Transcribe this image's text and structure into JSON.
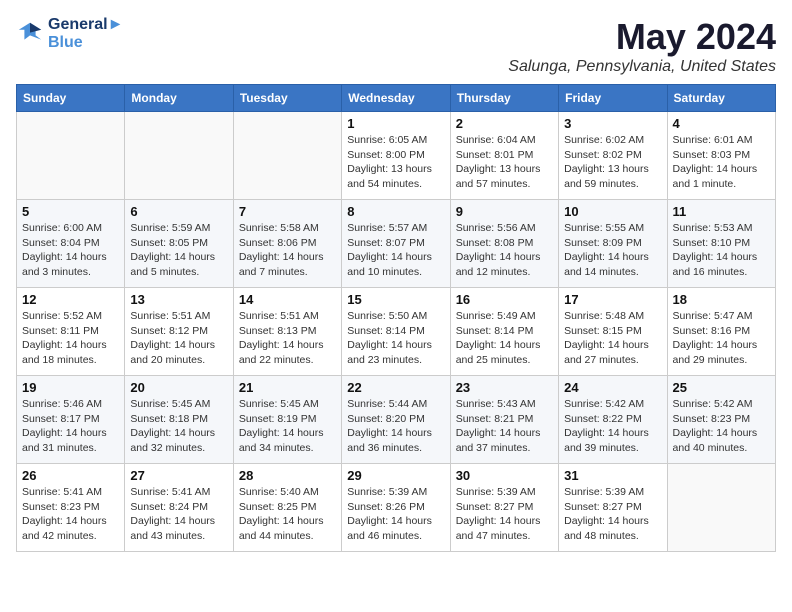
{
  "logo": {
    "line1": "General",
    "line2": "Blue"
  },
  "title": "May 2024",
  "location": "Salunga, Pennsylvania, United States",
  "days_of_week": [
    "Sunday",
    "Monday",
    "Tuesday",
    "Wednesday",
    "Thursday",
    "Friday",
    "Saturday"
  ],
  "weeks": [
    [
      {
        "day": "",
        "info": ""
      },
      {
        "day": "",
        "info": ""
      },
      {
        "day": "",
        "info": ""
      },
      {
        "day": "1",
        "info": "Sunrise: 6:05 AM\nSunset: 8:00 PM\nDaylight: 13 hours\nand 54 minutes."
      },
      {
        "day": "2",
        "info": "Sunrise: 6:04 AM\nSunset: 8:01 PM\nDaylight: 13 hours\nand 57 minutes."
      },
      {
        "day": "3",
        "info": "Sunrise: 6:02 AM\nSunset: 8:02 PM\nDaylight: 13 hours\nand 59 minutes."
      },
      {
        "day": "4",
        "info": "Sunrise: 6:01 AM\nSunset: 8:03 PM\nDaylight: 14 hours\nand 1 minute."
      }
    ],
    [
      {
        "day": "5",
        "info": "Sunrise: 6:00 AM\nSunset: 8:04 PM\nDaylight: 14 hours\nand 3 minutes."
      },
      {
        "day": "6",
        "info": "Sunrise: 5:59 AM\nSunset: 8:05 PM\nDaylight: 14 hours\nand 5 minutes."
      },
      {
        "day": "7",
        "info": "Sunrise: 5:58 AM\nSunset: 8:06 PM\nDaylight: 14 hours\nand 7 minutes."
      },
      {
        "day": "8",
        "info": "Sunrise: 5:57 AM\nSunset: 8:07 PM\nDaylight: 14 hours\nand 10 minutes."
      },
      {
        "day": "9",
        "info": "Sunrise: 5:56 AM\nSunset: 8:08 PM\nDaylight: 14 hours\nand 12 minutes."
      },
      {
        "day": "10",
        "info": "Sunrise: 5:55 AM\nSunset: 8:09 PM\nDaylight: 14 hours\nand 14 minutes."
      },
      {
        "day": "11",
        "info": "Sunrise: 5:53 AM\nSunset: 8:10 PM\nDaylight: 14 hours\nand 16 minutes."
      }
    ],
    [
      {
        "day": "12",
        "info": "Sunrise: 5:52 AM\nSunset: 8:11 PM\nDaylight: 14 hours\nand 18 minutes."
      },
      {
        "day": "13",
        "info": "Sunrise: 5:51 AM\nSunset: 8:12 PM\nDaylight: 14 hours\nand 20 minutes."
      },
      {
        "day": "14",
        "info": "Sunrise: 5:51 AM\nSunset: 8:13 PM\nDaylight: 14 hours\nand 22 minutes."
      },
      {
        "day": "15",
        "info": "Sunrise: 5:50 AM\nSunset: 8:14 PM\nDaylight: 14 hours\nand 23 minutes."
      },
      {
        "day": "16",
        "info": "Sunrise: 5:49 AM\nSunset: 8:14 PM\nDaylight: 14 hours\nand 25 minutes."
      },
      {
        "day": "17",
        "info": "Sunrise: 5:48 AM\nSunset: 8:15 PM\nDaylight: 14 hours\nand 27 minutes."
      },
      {
        "day": "18",
        "info": "Sunrise: 5:47 AM\nSunset: 8:16 PM\nDaylight: 14 hours\nand 29 minutes."
      }
    ],
    [
      {
        "day": "19",
        "info": "Sunrise: 5:46 AM\nSunset: 8:17 PM\nDaylight: 14 hours\nand 31 minutes."
      },
      {
        "day": "20",
        "info": "Sunrise: 5:45 AM\nSunset: 8:18 PM\nDaylight: 14 hours\nand 32 minutes."
      },
      {
        "day": "21",
        "info": "Sunrise: 5:45 AM\nSunset: 8:19 PM\nDaylight: 14 hours\nand 34 minutes."
      },
      {
        "day": "22",
        "info": "Sunrise: 5:44 AM\nSunset: 8:20 PM\nDaylight: 14 hours\nand 36 minutes."
      },
      {
        "day": "23",
        "info": "Sunrise: 5:43 AM\nSunset: 8:21 PM\nDaylight: 14 hours\nand 37 minutes."
      },
      {
        "day": "24",
        "info": "Sunrise: 5:42 AM\nSunset: 8:22 PM\nDaylight: 14 hours\nand 39 minutes."
      },
      {
        "day": "25",
        "info": "Sunrise: 5:42 AM\nSunset: 8:23 PM\nDaylight: 14 hours\nand 40 minutes."
      }
    ],
    [
      {
        "day": "26",
        "info": "Sunrise: 5:41 AM\nSunset: 8:23 PM\nDaylight: 14 hours\nand 42 minutes."
      },
      {
        "day": "27",
        "info": "Sunrise: 5:41 AM\nSunset: 8:24 PM\nDaylight: 14 hours\nand 43 minutes."
      },
      {
        "day": "28",
        "info": "Sunrise: 5:40 AM\nSunset: 8:25 PM\nDaylight: 14 hours\nand 44 minutes."
      },
      {
        "day": "29",
        "info": "Sunrise: 5:39 AM\nSunset: 8:26 PM\nDaylight: 14 hours\nand 46 minutes."
      },
      {
        "day": "30",
        "info": "Sunrise: 5:39 AM\nSunset: 8:27 PM\nDaylight: 14 hours\nand 47 minutes."
      },
      {
        "day": "31",
        "info": "Sunrise: 5:39 AM\nSunset: 8:27 PM\nDaylight: 14 hours\nand 48 minutes."
      },
      {
        "day": "",
        "info": ""
      }
    ]
  ]
}
